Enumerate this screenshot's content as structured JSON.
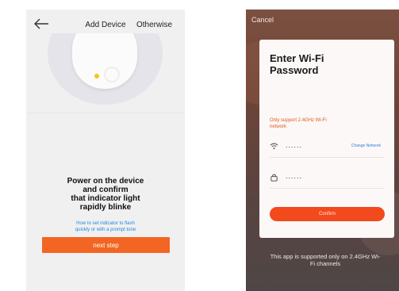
{
  "left_screen": {
    "header": {
      "back_icon": "arrow-left-icon",
      "title": "Add Device",
      "otherwise_label": "Otherwise"
    },
    "instruction_lines": [
      "Power on the device",
      "and confirm",
      "that indicator light",
      "rapidly blinke"
    ],
    "help_link_lines": [
      "How to set indicator to flash",
      "quickly or with a prompt tone"
    ],
    "next_step_label": "next step",
    "colors": {
      "accent": "#f26522",
      "link": "#1e88e5",
      "background": "#f0f0f0"
    }
  },
  "right_screen": {
    "cancel_label": "Cancel",
    "card": {
      "title_lines": [
        "Enter Wi-Fi",
        "Password"
      ],
      "note_lines": [
        "Only support 2.4GHz Wi-Fi",
        "network"
      ],
      "wifi_row": {
        "icon": "wifi-icon",
        "value": "......",
        "change_label": "Change Network"
      },
      "password_row": {
        "icon": "lock-icon",
        "value": "......"
      },
      "confirm_label": "Confirm"
    },
    "support_note_lines": [
      "This app is supported only on 2.4GHz Wi-",
      "Fi channels"
    ],
    "colors": {
      "accent": "#f24a1d",
      "note": "#e05a1c"
    }
  }
}
